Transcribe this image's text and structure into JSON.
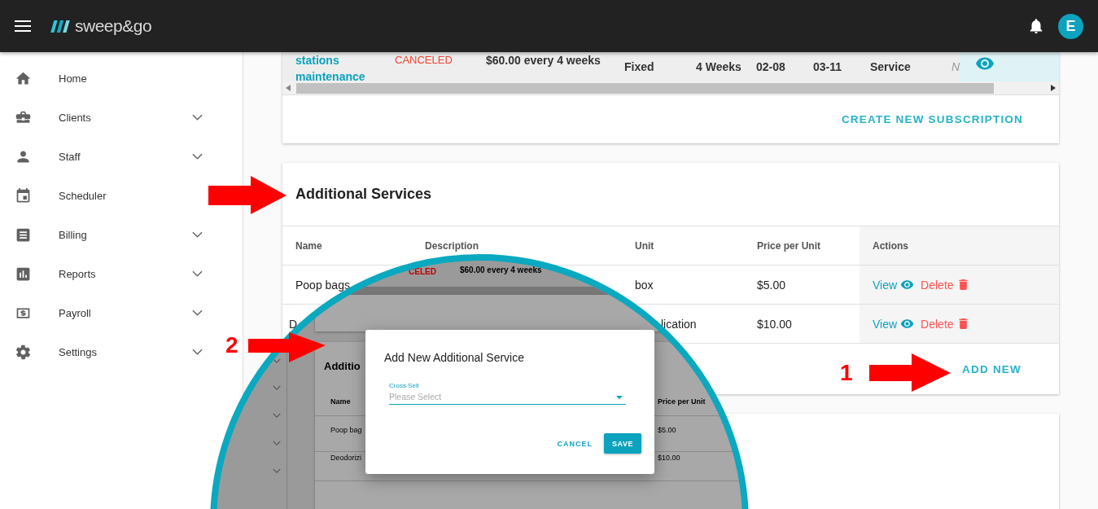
{
  "header": {
    "logo": "sweep&go",
    "avatar": "E"
  },
  "sidebar": {
    "items": [
      {
        "label": "Home",
        "expandable": false
      },
      {
        "label": "Clients",
        "expandable": true
      },
      {
        "label": "Staff",
        "expandable": true
      },
      {
        "label": "Scheduler",
        "expandable": false
      },
      {
        "label": "Billing",
        "expandable": true
      },
      {
        "label": "Reports",
        "expandable": true
      },
      {
        "label": "Payroll",
        "expandable": true
      },
      {
        "label": "Settings",
        "expandable": true
      }
    ]
  },
  "subscriptions": {
    "row": [
      {
        "kind": "link",
        "text": "stations maintenance"
      },
      {
        "kind": "status",
        "text": "CANCELED"
      },
      {
        "kind": "strong",
        "text": "$60.00 every 4 weeks"
      },
      {
        "kind": "strong",
        "text": "Fixed"
      },
      {
        "kind": "strong",
        "text": "4 Weeks"
      },
      {
        "kind": "strong",
        "text": "02-08"
      },
      {
        "kind": "strong",
        "text": "03-11"
      },
      {
        "kind": "strong",
        "text": "Service"
      },
      {
        "kind": "muted",
        "text": "N"
      }
    ],
    "create_button": "CREATE NEW SUBSCRIPTION"
  },
  "additional_services": {
    "title": "Additional Services",
    "columns": [
      "Name",
      "Description",
      "Unit",
      "Price per Unit",
      "Actions"
    ],
    "rows": [
      {
        "name": "Poop bags",
        "unit": "box",
        "price": "$5.00",
        "view": "View",
        "delete": "Delete"
      },
      {
        "name": "D",
        "unit": "lication",
        "price": "$10.00",
        "view": "View",
        "delete": "Delete"
      }
    ],
    "add_button": "ADD NEW"
  },
  "magnifier": {
    "status": "CELED",
    "price": "$60.00 every 4 weeks",
    "card_title": "Additio",
    "columns": [
      "Name",
      "Price per Unit"
    ],
    "rows": [
      {
        "name": "Poop bag",
        "price": "$5.00"
      },
      {
        "name": "Deodorizi",
        "price": "$10.00"
      }
    ],
    "dialog": {
      "title": "Add New Additional Service",
      "field_label": "Cross Sell",
      "placeholder": "Please Select",
      "cancel": "CANCEL",
      "save": "SAVE"
    }
  },
  "annotations": [
    {
      "label": "1"
    },
    {
      "label": "2"
    }
  ]
}
